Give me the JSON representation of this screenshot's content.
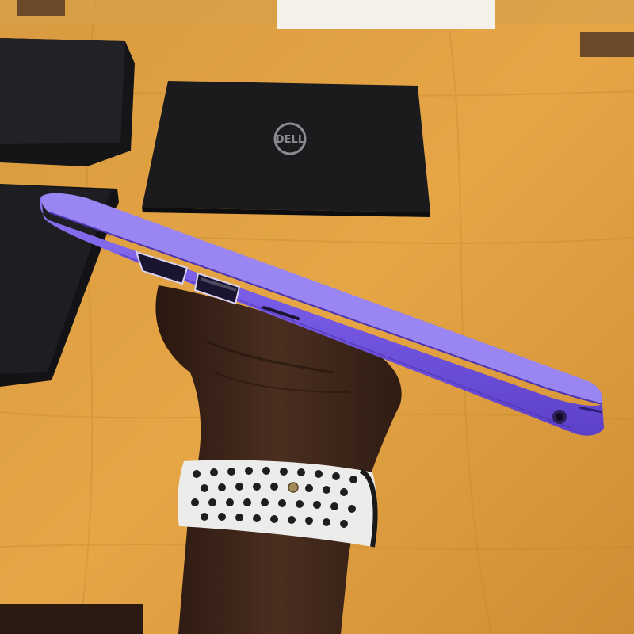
{
  "scene": {
    "colors": {
      "table": "#e2a03e",
      "table_dark": "#c98a2c",
      "laptop_black": "#1b1b1d",
      "laptop_purple": "#7b5fe6",
      "purple_dark": "#5a3fc4",
      "skin": "#3a2418",
      "watch_band": "#e8e8e6",
      "watch_holes": "#222222"
    },
    "objects": [
      "black-laptop-top-left",
      "dell-laptop-center",
      "black-laptop-left-mid",
      "purple-laptop-side-view",
      "hand",
      "sport-watch-band"
    ],
    "ports": [
      "hdmi-port",
      "usb-a-port",
      "sd-card-slot",
      "audio-jack"
    ]
  }
}
